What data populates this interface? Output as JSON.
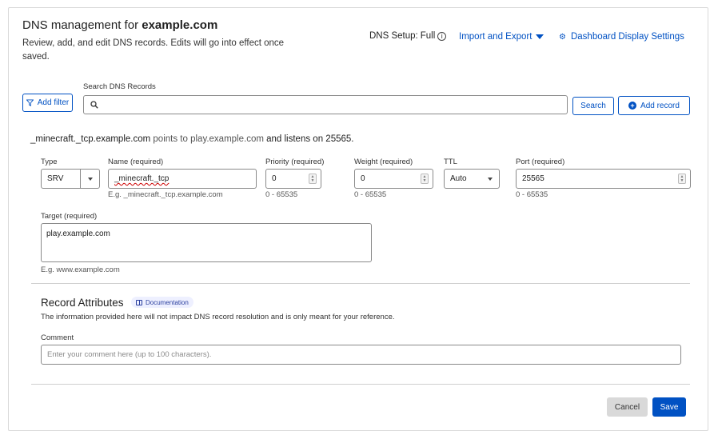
{
  "header": {
    "title_prefix": "DNS management for ",
    "title_domain": "example.com",
    "subtitle": "Review, add, and edit DNS records. Edits will go into effect once saved.",
    "dns_setup_label": "DNS Setup:",
    "dns_setup_value": "Full",
    "import_export_label": "Import and Export",
    "dashboard_settings_label": "Dashboard Display Settings"
  },
  "toolbar": {
    "add_filter_label": "Add filter",
    "search_label": "Search DNS Records",
    "search_value": "",
    "search_button_label": "Search",
    "add_record_label": "Add record"
  },
  "record_summary": {
    "name": "_minecraft._tcp.example.com",
    "points_to_text": "points to",
    "target": "play.example.com",
    "listens_text": "and listens on",
    "port": "25565."
  },
  "form": {
    "type_label": "Type",
    "type_value": "SRV",
    "name_label": "Name (required)",
    "name_value": "_minecraft._tcp",
    "name_help": "E.g. _minecraft._tcp.example.com",
    "priority_label": "Priority (required)",
    "priority_value": "0",
    "priority_help": "0 - 65535",
    "weight_label": "Weight (required)",
    "weight_value": "0",
    "weight_help": "0 - 65535",
    "ttl_label": "TTL",
    "ttl_value": "Auto",
    "port_label": "Port (required)",
    "port_value": "25565",
    "port_help": "0 - 65535",
    "target_label": "Target (required)",
    "target_value": "play.example.com",
    "target_help": "E.g. www.example.com"
  },
  "record_attributes": {
    "title": "Record Attributes",
    "doc_badge_label": "Documentation",
    "description": "The information provided here will not impact DNS record resolution and is only meant for your reference.",
    "comment_label": "Comment",
    "comment_placeholder": "Enter your comment here (up to 100 characters)."
  },
  "actions": {
    "cancel_label": "Cancel",
    "save_label": "Save"
  },
  "colors": {
    "accent": "#0051c3",
    "border": "#8a8a8a",
    "cancel_bg": "#d9d9d9"
  }
}
